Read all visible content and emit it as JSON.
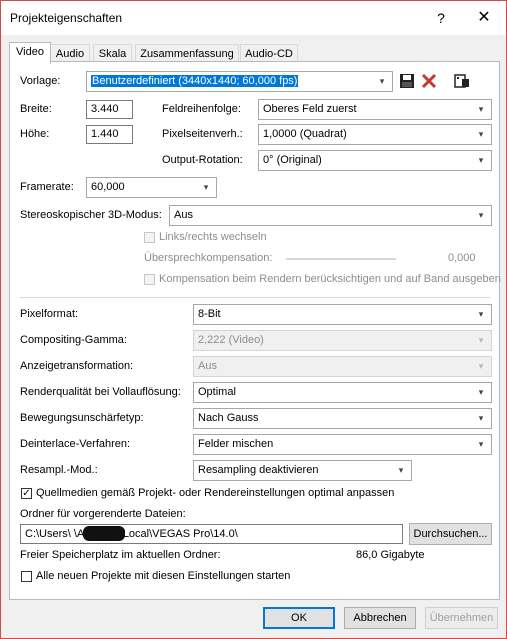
{
  "window": {
    "title": "Projekteigenschaften",
    "help_label": "?",
    "close_label": "✕"
  },
  "tabs": [
    "Video",
    "Audio",
    "Skala",
    "Zusammenfassung",
    "Audio-CD"
  ],
  "video": {
    "template_label": "Vorlage:",
    "template_value": "Benutzerdefiniert (3440x1440; 60,000 fps)",
    "width_label": "Breite:",
    "width_value": "3.440",
    "height_label": "Höhe:",
    "height_value": "1.440",
    "field_order_label": "Feldreihenfolge:",
    "field_order_value": "Oberes Feld zuerst",
    "pixel_aspect_label": "Pixelseitenverh.:",
    "pixel_aspect_value": "1,0000 (Quadrat)",
    "output_rotation_label": "Output-Rotation:",
    "output_rotation_value": "0° (Original)",
    "framerate_label": "Framerate:",
    "framerate_value": "60,000",
    "stereo_label": "Stereoskopischer 3D-Modus:",
    "stereo_value": "Aus",
    "swap_lr_label": "Links/rechts wechseln",
    "crosstalk_label": "Übersprechkompensation:",
    "crosstalk_value": "0,000",
    "crosstalk_render_label": "Kompensation beim Rendern berücksichtigen und auf Band ausgeben",
    "pixel_format_label": "Pixelformat:",
    "pixel_format_value": "8-Bit",
    "compositing_gamma_label": "Compositing-Gamma:",
    "compositing_gamma_value": "2,222 (Video)",
    "view_transform_label": "Anzeigetransformation:",
    "view_transform_value": "Aus",
    "render_quality_label": "Renderqualität bei Vollauflösung:",
    "render_quality_value": "Optimal",
    "motion_blur_label": "Bewegungsunschärfetyp:",
    "motion_blur_value": "Nach Gauss",
    "deinterlace_label": "Deinterlace-Verfahren:",
    "deinterlace_value": "Felder mischen",
    "resample_label": "Resampl.-Mod.:",
    "resample_value": "Resampling deaktivieren",
    "adjust_source_label": "Quellmedien gemäß Projekt- oder Rendereinstellungen optimal anpassen",
    "adjust_source_checked": true,
    "prerender_folder_label": "Ordner für vorgerenderte Dateien:",
    "prerender_folder_value": "C:\\Users\\        \\AppData\\Local\\VEGAS Pro\\14.0\\",
    "browse_label": "Durchsuchen...",
    "free_space_label": "Freier Speicherplatz im aktuellen Ordner:",
    "free_space_value": "86,0 Gigabyte",
    "start_all_label": "Alle neuen Projekte mit diesen Einstellungen starten",
    "start_all_checked": false
  },
  "buttons": {
    "ok": "OK",
    "cancel": "Abbrechen",
    "apply": "Übernehmen"
  },
  "icons": {
    "save": "save-icon",
    "delete": "delete-icon",
    "match_media": "match-media-icon"
  },
  "colors": {
    "selection": "#0078d7",
    "delete_red": "#c0392b",
    "window_border": "#d04a4a"
  }
}
